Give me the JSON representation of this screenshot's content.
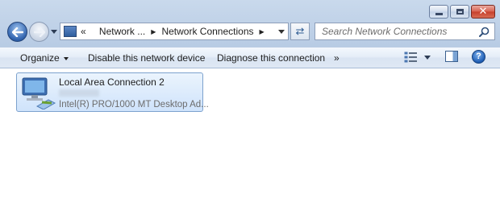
{
  "window": {
    "caption": {
      "min_icon": "minimize-icon",
      "max_icon": "maximize-icon",
      "close_icon": "close-icon"
    }
  },
  "nav": {
    "back_icon": "back-arrow-icon",
    "forward_icon": "forward-arrow-icon",
    "breadcrumb": {
      "overflow": "«",
      "items": [
        "Network ...",
        "Network Connections"
      ]
    },
    "search": {
      "placeholder": "Search Network Connections"
    }
  },
  "commandbar": {
    "organize": "Organize",
    "disable": "Disable this network device",
    "diagnose": "Diagnose this connection",
    "more": "»"
  },
  "items": [
    {
      "name": "Local Area Connection 2",
      "device": "Intel(R) PRO/1000 MT Desktop Ad..."
    }
  ],
  "colors": {
    "accent": "#2f62ad",
    "selection": "#cfe3fb",
    "close": "#c63f2c"
  }
}
